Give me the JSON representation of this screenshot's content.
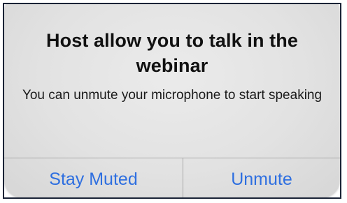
{
  "dialog": {
    "title": "Host allow you to talk in the webinar",
    "message": "You can unmute your microphone to start speaking",
    "buttons": {
      "stay_muted": "Stay Muted",
      "unmute": "Unmute"
    }
  },
  "colors": {
    "accent": "#2e6fe0",
    "dialog_bg": "#e4e4e4",
    "divider": "#a8a8a8"
  }
}
